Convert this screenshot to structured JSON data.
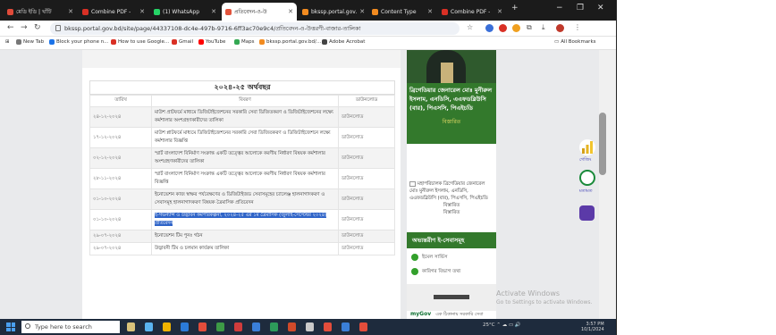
{
  "tabs": [
    {
      "label": "মেডি ইডি | খাঁটি",
      "color": "#e04b3a",
      "active": false
    },
    {
      "label": "Combine PDF -",
      "color": "#d93025",
      "active": false
    },
    {
      "label": "(1) WhatsApp",
      "color": "#25d366",
      "active": false
    },
    {
      "label": "প্রতিবেদন-ও-উ",
      "color": "#e2543c",
      "active": true
    },
    {
      "label": "bkssp.portal.gov.",
      "color": "#f28b20",
      "active": false
    },
    {
      "label": "Content Type",
      "color": "#f28b20",
      "active": false
    },
    {
      "label": "Combine PDF -",
      "color": "#d93025",
      "active": false
    }
  ],
  "window_controls": {
    "minimize": "−",
    "maximize": "❐",
    "close": "✕",
    "new_tab": "+"
  },
  "address_bar": {
    "url": "bkssp.portal.gov.bd/site/page/44337108-dc4e-497b-9716-6ff3ac70e9c4/প্রতিবেদন-ও-উত্তরণী-বাজার-তালিকা"
  },
  "bookmarks": {
    "items": [
      {
        "label": "New Tab",
        "color": "#777"
      },
      {
        "label": "Block your phone n...",
        "color": "#1a73e8"
      },
      {
        "label": "How to use Google...",
        "color": "#d93025"
      },
      {
        "label": "Gmail",
        "color": "#d93025"
      },
      {
        "label": "YouTube",
        "color": "#ff0000"
      },
      {
        "label": "Maps",
        "color": "#34a853"
      },
      {
        "label": "bkssp.portal.gov.bd/...",
        "color": "#f28b20"
      },
      {
        "label": "Adobe Acrobat",
        "color": "#444"
      }
    ],
    "all_bookmarks": "All Bookmarks"
  },
  "main": {
    "fiscal_year_title": "২০২৪-২৫ অর্থবছর",
    "columns": [
      "তারিখ",
      "বিবরণ",
      "ডাউনলোড"
    ],
    "rows": [
      {
        "date": "২৪-১২-২০২৪",
        "description": "মাউশ প্রাটফর্মে মাধ্যমে ডিজিটাইজেশনের সরকারি সেবা ডিজিতকরণ ও ডিজিটাইজেশনের লক্ষ্যে কর্মশালার অংশগ্রহণকারীদের তালিকা",
        "download": "ডাউনলোড",
        "highlight": false
      },
      {
        "date": "১৭-১২-২০২৪",
        "description": "মাউশ প্লাটফর্মে মাধ্যমে ডিজিটাইজেশনের সরকারি সেবা ডিজিতকরণ ও ডিজিটাইজেশনে লক্ষ্যে কর্মশালার বিজ্ঞপ্তি",
        "download": "ডাউনলোড",
        "highlight": false
      },
      {
        "date": "০২-১২-২০২৪",
        "description": "স্মার্ট বাংলাদেশ বিনির্মাণ সংক্রান্ত একটি তত্ত্বের আলোকে করণীয় নির্ধারণ বিষয়ক কর্মশালার অংশগ্রহণকারীদের তালিকা",
        "download": "ডাউনলোড",
        "highlight": false
      },
      {
        "date": "২৮-১১-২০২৪",
        "description": "স্মার্ট বাংলাদেশ বিনির্মাণ সংক্রান্ত একটি তত্ত্বের আলোকে করণীয় নির্ধারণ বিষয়ক কর্মশালার বিজ্ঞপ্তি",
        "download": "ডাউনলোড",
        "highlight": false
      },
      {
        "date": "০১-১০-২০২৪",
        "description": "ইনোভেশন কাজ স্বাক্ষর পর্যবেক্ষণের ও ডিজিটাইজড সেবাসমূহের চ্যালেঞ্জ হালনাগাদকরণ ও সেবাসমূহ হালনাগাদকরণ বিষয়ক ত্রৈমাসিক প্রতিবেদন",
        "download": "ডাউনলোড",
        "highlight": false
      },
      {
        "date": "০১-১০-২০২৪",
        "description": "ই-গভর্ন্যান্স ও উদ্ভাবন কর্মপরিকল্পনা, ২০২৪-২৫ এর ১ম ত্রৈমাসিক (জুলাই-সেপ্টেম্বর ২০২৪) প্রতিবেদন",
        "download": "ডাউনলোড",
        "highlight": true
      },
      {
        "date": "২৯-০৭-২০২৪",
        "description": "ইনোভেশন টিম পুনঃ গঠন",
        "download": "ডাউনলোড",
        "highlight": false
      },
      {
        "date": "২৯-০৭-২০২৪",
        "description": "উদ্ভাবনী টিম ও চলমান কার্যক্রম তালিকা",
        "download": "ডাউনলোড",
        "highlight": false
      }
    ]
  },
  "sidebar": {
    "profile_name": "ব্রিগেডিয়ার জেনারেল মোঃ মুনীরুল ইসলাম, এনডিসি, এএফডব্লিউসি (বার), পিএসসি, পিএইচডি",
    "profile_link": "বিস্তারিত",
    "image_alt": "মহাপরিচালক ব্রিগেডিয়ার জেনারেল মোঃ মুনীরুল ইসলাম, এনডিসি, এএফডব্লিউসি (বার), পিএসসি, পিএইচডি",
    "image_caption": "বিস্তারিত",
    "image_caption_2": "বিস্তারিত",
    "eservices_heading": "অভ্যন্তরীণ ই-সেবাসমূহ",
    "eservices": [
      "ইমেল সার্ভিস",
      "কারিগর বিভাগ তথ্য"
    ],
    "mygov_label": "myGov",
    "mygov_text": "এক ঠিকানায় সরকারি সেবা"
  },
  "floating": {
    "chart_label": "গেজিং",
    "chat_label": "মতামত"
  },
  "watermark": {
    "line1": "Activate Windows",
    "line2": "Go to Settings to activate Windows."
  },
  "taskbar": {
    "search_placeholder": "Type here to search",
    "weather": "25°C",
    "time": "3:57 PM",
    "date": "10/1/2024"
  },
  "colors": {
    "accent_green": "#33792c",
    "highlight_blue": "#2f64c8",
    "taskbar": "#1e2b3d"
  }
}
